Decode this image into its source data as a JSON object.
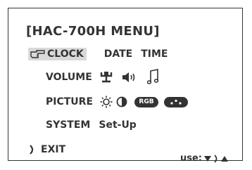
{
  "menu": {
    "title": "[HAC-700H MENU]",
    "clock": {
      "label": "CLOCK",
      "options": [
        "DATE",
        "TIME"
      ]
    },
    "volume": {
      "label": "VOLUME",
      "icons": [
        "microphone-icon",
        "speaker-icon",
        "music-note-icon"
      ]
    },
    "picture": {
      "label": "PICTURE",
      "icons": [
        "brightness-icon",
        "contrast-icon",
        "rgb-icon",
        "dots-icon"
      ],
      "rgb_text": "RGB"
    },
    "system": {
      "label": "SYSTEM",
      "value": "Set-Up"
    },
    "exit": {
      "label": "EXIT"
    },
    "hint": {
      "label": "use:"
    }
  },
  "colors": {
    "text": "#333333",
    "highlight": "#d9d9d9",
    "background": "#ffffff"
  }
}
